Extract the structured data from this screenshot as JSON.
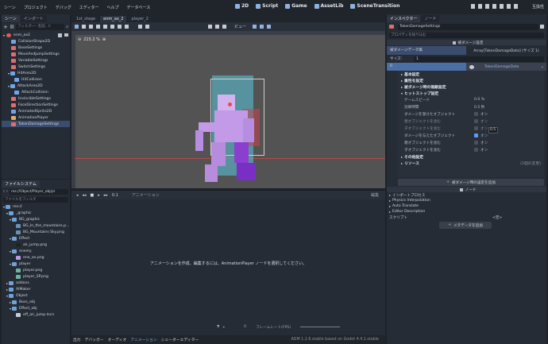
{
  "menu": [
    "シーン",
    "プロジェクト",
    "デバッグ",
    "エディター",
    "ヘルプ",
    "データベース"
  ],
  "workspaces": [
    {
      "label": "2D",
      "icon": "2d-icon"
    },
    {
      "label": "Script",
      "icon": "script-icon"
    },
    {
      "label": "Game",
      "icon": "game-icon"
    },
    {
      "label": "AssetLib",
      "icon": "assetlib-icon"
    },
    {
      "label": "SceneTransition",
      "icon": "scene-transition-icon"
    }
  ],
  "run_label": "互換性",
  "scene_panel": {
    "tabs": [
      "シーン",
      "インポート"
    ],
    "filter_placeholder": "フィルター: 名前、t:",
    "root": "enm_ax2",
    "nodes": [
      "CollisionShape2D",
      "BaseSettings",
      "MoveAndJumpSettings",
      "VariableSettings",
      "SwitchSettings",
      "HitArea2D",
      "HitCollision",
      "AttackArea2D",
      "AttackCollision",
      "InvincibleSettings",
      "FaceDirectionSettings",
      "AnimatedSprite2D",
      "AnimationPlayer",
      "TakenDamageSettings"
    ]
  },
  "filesystem": {
    "title": "ファイルシステム",
    "path": "res://Object/Player_obj/pl",
    "filter": "ファイルをフィルタ",
    "items": [
      "res://",
      "_graphic",
      "BG_graphic",
      "BG_In_the_mountains.p...",
      "BG_Mountains Sky.png",
      "Effect",
      "air_jump.png",
      "enemy",
      "ene_ax.png",
      "player",
      "player.png",
      "player_SP.png",
      "addons",
      "AIMaker",
      "Object",
      "Boss_obj",
      "Effect_obj",
      "eff_air_jump.tscn"
    ]
  },
  "editor_tabs": [
    "1st_stage",
    "enm_ax_2",
    "player_2"
  ],
  "viewport": {
    "zoom": "215.2 %",
    "view_label": "ビュー"
  },
  "animation": {
    "label": "アニメーション",
    "time": "0.1",
    "edit": "編集",
    "message": "アニメーションを作成、編集するには、AnimationPlayer ノードを選択してください。",
    "fps_label": "フレームレート(FPS)",
    "snap": "0"
  },
  "bottom_tabs": [
    "出力",
    "デバッガー",
    "オーディオ",
    "アニメーション",
    "シェーダーエディター"
  ],
  "version": "AGM 1.2.6.stable based on Godot 4.4.1.stable",
  "inspector": {
    "tabs": [
      "インスペクター",
      "ノード"
    ],
    "node_name": "TakenDamageSettings",
    "filter": "プロパティを絞り込む",
    "group_title": "被ダメージ設定",
    "array_label": "被ダメージデータ集",
    "array_value": "Array[TakenDamageData] (サイズ 1)",
    "size_label": "サイズ:",
    "size_value": "1",
    "index": "0",
    "resource": "TakenDamageData",
    "sections": [
      "基本設定",
      "属性を設定",
      "被ダメージ時の無敵設定",
      "ヒットストップ設定"
    ],
    "props": [
      {
        "label": "ゲームスピード",
        "value": "0.0 %",
        "type": "num"
      },
      {
        "label": "効果時間",
        "value": "0.5 秒",
        "type": "num"
      },
      {
        "label": "ダメージを受けたオブジェクト",
        "value": "オン",
        "type": "check",
        "on": false
      },
      {
        "label": "親オブジェクトを含む",
        "value": "オン",
        "type": "check",
        "on": false
      },
      {
        "label": "子オブジェクトを含む",
        "value": "オン",
        "type": "check",
        "on": false
      },
      {
        "label": "ダメージを与えたオブジェクト",
        "value": "オン",
        "type": "check",
        "on": true
      },
      {
        "label": "親オブジェクトを含む",
        "value": "オン",
        "type": "check",
        "on": false
      },
      {
        "label": "子オブジェクトを含む",
        "value": "オン",
        "type": "check",
        "on": false
      }
    ],
    "tooltip": "0.5",
    "more_sections": [
      "その他設定",
      "リソース"
    ],
    "resource_count": "(1個の変更)",
    "add_button": "被ダメージ時の設定を追加",
    "node_label": "ノード",
    "categories": [
      "インポートプロセス",
      "Physics Interpolation",
      "Auto Translate",
      "Editor Description"
    ],
    "script_label": "スクリプト",
    "script_value": "<空>",
    "meta_button": "メタデータを追加"
  }
}
